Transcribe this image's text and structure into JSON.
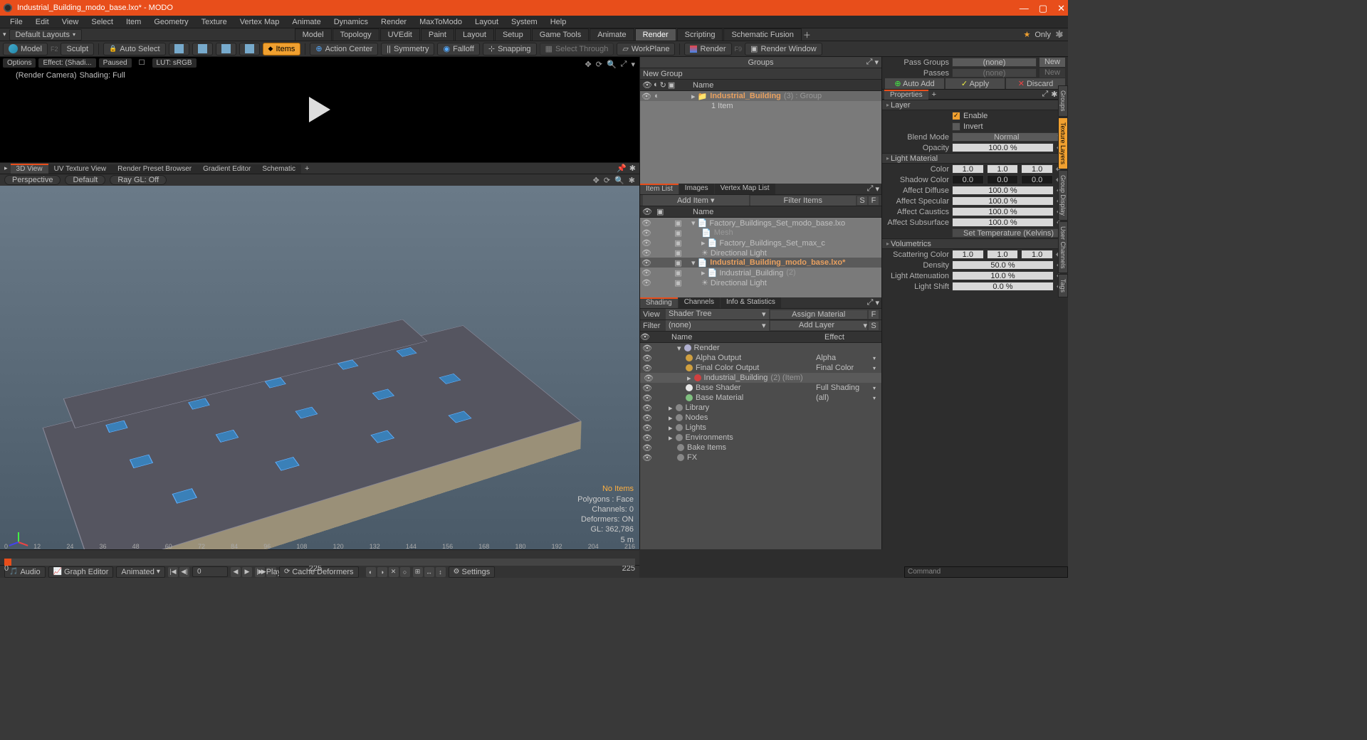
{
  "title": "Industrial_Building_modo_base.lxo* - MODO",
  "menus": [
    "File",
    "Edit",
    "View",
    "Select",
    "Item",
    "Geometry",
    "Texture",
    "Vertex Map",
    "Animate",
    "Dynamics",
    "Render",
    "MaxToModo",
    "Layout",
    "System",
    "Help"
  ],
  "defaultLayouts": "Default Layouts",
  "layoutTabs": [
    "Model",
    "Topology",
    "UVEdit",
    "Paint",
    "Layout",
    "Setup",
    "Game Tools",
    "Animate",
    "Render",
    "Scripting",
    "Schematic Fusion"
  ],
  "layoutActive": "Render",
  "only": "Only",
  "toolbar": {
    "model": "Model",
    "f2": "F2",
    "sculpt": "Sculpt",
    "autoSelect": "Auto Select",
    "items": "Items",
    "actionCenter": "Action Center",
    "symmetry": "Symmetry",
    "falloff": "Falloff",
    "snapping": "Snapping",
    "selectThrough": "Select Through",
    "workPlane": "WorkPlane",
    "render": "Render",
    "f9": "F9",
    "renderWindow": "Render Window"
  },
  "renderPrev": {
    "options": "Options",
    "effect": "Effect: (Shadi...",
    "paused": "Paused",
    "lut": "LUT: sRGB",
    "renderCamera": "(Render Camera)",
    "shadingFull": "Shading: Full"
  },
  "viewTabs": [
    "3D View",
    "UV Texture View",
    "Render Preset Browser",
    "Gradient Editor",
    "Schematic"
  ],
  "viewOpts": {
    "perspective": "Perspective",
    "default": "Default",
    "raygl": "Ray GL: Off"
  },
  "viewportInfo": {
    "noitems": "No Items",
    "polygons": "Polygons : Face",
    "channels": "Channels: 0",
    "deformers": "Deformers: ON",
    "gl": "GL: 362,786",
    "scale": "5 m"
  },
  "timeline": {
    "ticks": [
      "0",
      "12",
      "24",
      "36",
      "48",
      "60",
      "72",
      "84",
      "96",
      "108",
      "120",
      "132",
      "144",
      "156",
      "168",
      "180",
      "192",
      "204",
      "216"
    ],
    "cur": "0",
    "rangeA": "0",
    "rangeB": "225",
    "rangeC": "225"
  },
  "bottom": {
    "audio": "Audio",
    "graphEditor": "Graph Editor",
    "animated": "Animated",
    "frame": "0",
    "play": "Play",
    "cacheDeformers": "Cache Deformers",
    "settings": "Settings"
  },
  "groups": {
    "title": "Groups",
    "newGroup": "New Group",
    "nameHdr": "Name",
    "rowName": "Industrial_Building",
    "rowSuffix": "(3) : Group",
    "subCount": "1 Item"
  },
  "itemListTabs": [
    "Item List",
    "Images",
    "Vertex Map List"
  ],
  "itemList": {
    "addItem": "Add Item",
    "filterItems": "Filter Items",
    "s": "S",
    "f": "F",
    "nameHdr": "Name",
    "rows": [
      {
        "indent": 0,
        "tri": "▾",
        "name": "Factory_Buildings_Set_modo_base.lxo",
        "bold": false
      },
      {
        "indent": 1,
        "tri": "",
        "name": "Mesh",
        "dim": true
      },
      {
        "indent": 1,
        "tri": "▸",
        "name": "Factory_Buildings_Set_max_c",
        "bold": false
      },
      {
        "indent": 1,
        "tri": "",
        "name": "Directional Light",
        "icon": "light"
      },
      {
        "indent": 0,
        "tri": "▾",
        "name": "Industrial_Building_modo_base.lxo*",
        "bold": true
      },
      {
        "indent": 1,
        "tri": "▸",
        "name": "Industrial_Building",
        "suffix": "(2)"
      },
      {
        "indent": 1,
        "tri": "",
        "name": "Directional Light",
        "icon": "light"
      }
    ]
  },
  "shadingTabs": [
    "Shading",
    "Channels",
    "Info & Statistics"
  ],
  "shading": {
    "view": "View",
    "shaderTree": "Shader Tree",
    "assign": "Assign Material",
    "f": "F",
    "filter": "Filter",
    "none": "(none)",
    "addLayer": "Add Layer",
    "s": "S",
    "nameHdr": "Name",
    "effectHdr": "Effect",
    "rows": [
      {
        "d": 1,
        "tri": "▾",
        "name": "Render",
        "eff": "",
        "sb": "#b0b0d0"
      },
      {
        "d": 2,
        "tri": "",
        "name": "Alpha Output",
        "eff": "Alpha",
        "sb": "#d0a040"
      },
      {
        "d": 2,
        "tri": "",
        "name": "Final Color Output",
        "eff": "Final Color",
        "sb": "#d0a040"
      },
      {
        "d": 2,
        "tri": "▸",
        "name": "Industrial_Building",
        "suffix": "(2) (Item)",
        "eff": "",
        "sb": "#d04040",
        "selected": true
      },
      {
        "d": 2,
        "tri": "",
        "name": "Base Shader",
        "eff": "Full Shading",
        "sb": "#e8e8e8"
      },
      {
        "d": 2,
        "tri": "",
        "name": "Base Material",
        "eff": "(all)",
        "sb": "#80c080"
      },
      {
        "d": 0,
        "tri": "▸",
        "name": "Library",
        "eff": ""
      },
      {
        "d": 0,
        "tri": "▸",
        "name": "Nodes",
        "eff": ""
      },
      {
        "d": 0,
        "tri": "▸",
        "name": "Lights",
        "eff": ""
      },
      {
        "d": 0,
        "tri": "▸",
        "name": "Environments",
        "eff": ""
      },
      {
        "d": 1,
        "tri": "",
        "name": "Bake Items",
        "eff": ""
      },
      {
        "d": 1,
        "tri": "",
        "name": "FX",
        "eff": "",
        "icon": "fx"
      }
    ]
  },
  "passes": {
    "passGroups": "Pass Groups",
    "passesLbl": "Passes",
    "none": "(none)",
    "new": "New",
    "autoAdd": "Auto Add",
    "apply": "Apply",
    "discard": "Discard"
  },
  "propsHdr": "Properties",
  "props": {
    "layer": "Layer",
    "enable": "Enable",
    "invert": "Invert",
    "blendMode": "Blend Mode",
    "blendVal": "Normal",
    "opacity": "Opacity",
    "opacityVal": "100.0 %",
    "lightMat": "Light Material",
    "color": "Color",
    "colorVal": [
      "1.0",
      "1.0",
      "1.0"
    ],
    "shadowColor": "Shadow Color",
    "shadowVal": [
      "0.0",
      "0.0",
      "0.0"
    ],
    "affectDiffuse": "Affect Diffuse",
    "affectDiffuseVal": "100.0 %",
    "affectSpecular": "Affect Specular",
    "affectSpecularVal": "100.0 %",
    "affectCaustics": "Affect Caustics",
    "affectCausticsVal": "100.0 %",
    "affectSubsurface": "Affect Subsurface",
    "affectSubsurfaceVal": "100.0 %",
    "setTemp": "Set Temperature (Kelvins)",
    "volumetrics": "Volumetrics",
    "scatteringColor": "Scattering Color",
    "scatteringVal": [
      "1.0",
      "1.0",
      "1.0"
    ],
    "density": "Density",
    "densityVal": "50.0 %",
    "lightAtten": "Light Attenuation",
    "lightAttenVal": "10.0 %",
    "lightShift": "Light Shift",
    "lightShiftVal": "0.0 %"
  },
  "sideTabs": [
    "Groups",
    "Texture Layers",
    "Group Display",
    "User Channels",
    "Tags"
  ],
  "command": "Command"
}
